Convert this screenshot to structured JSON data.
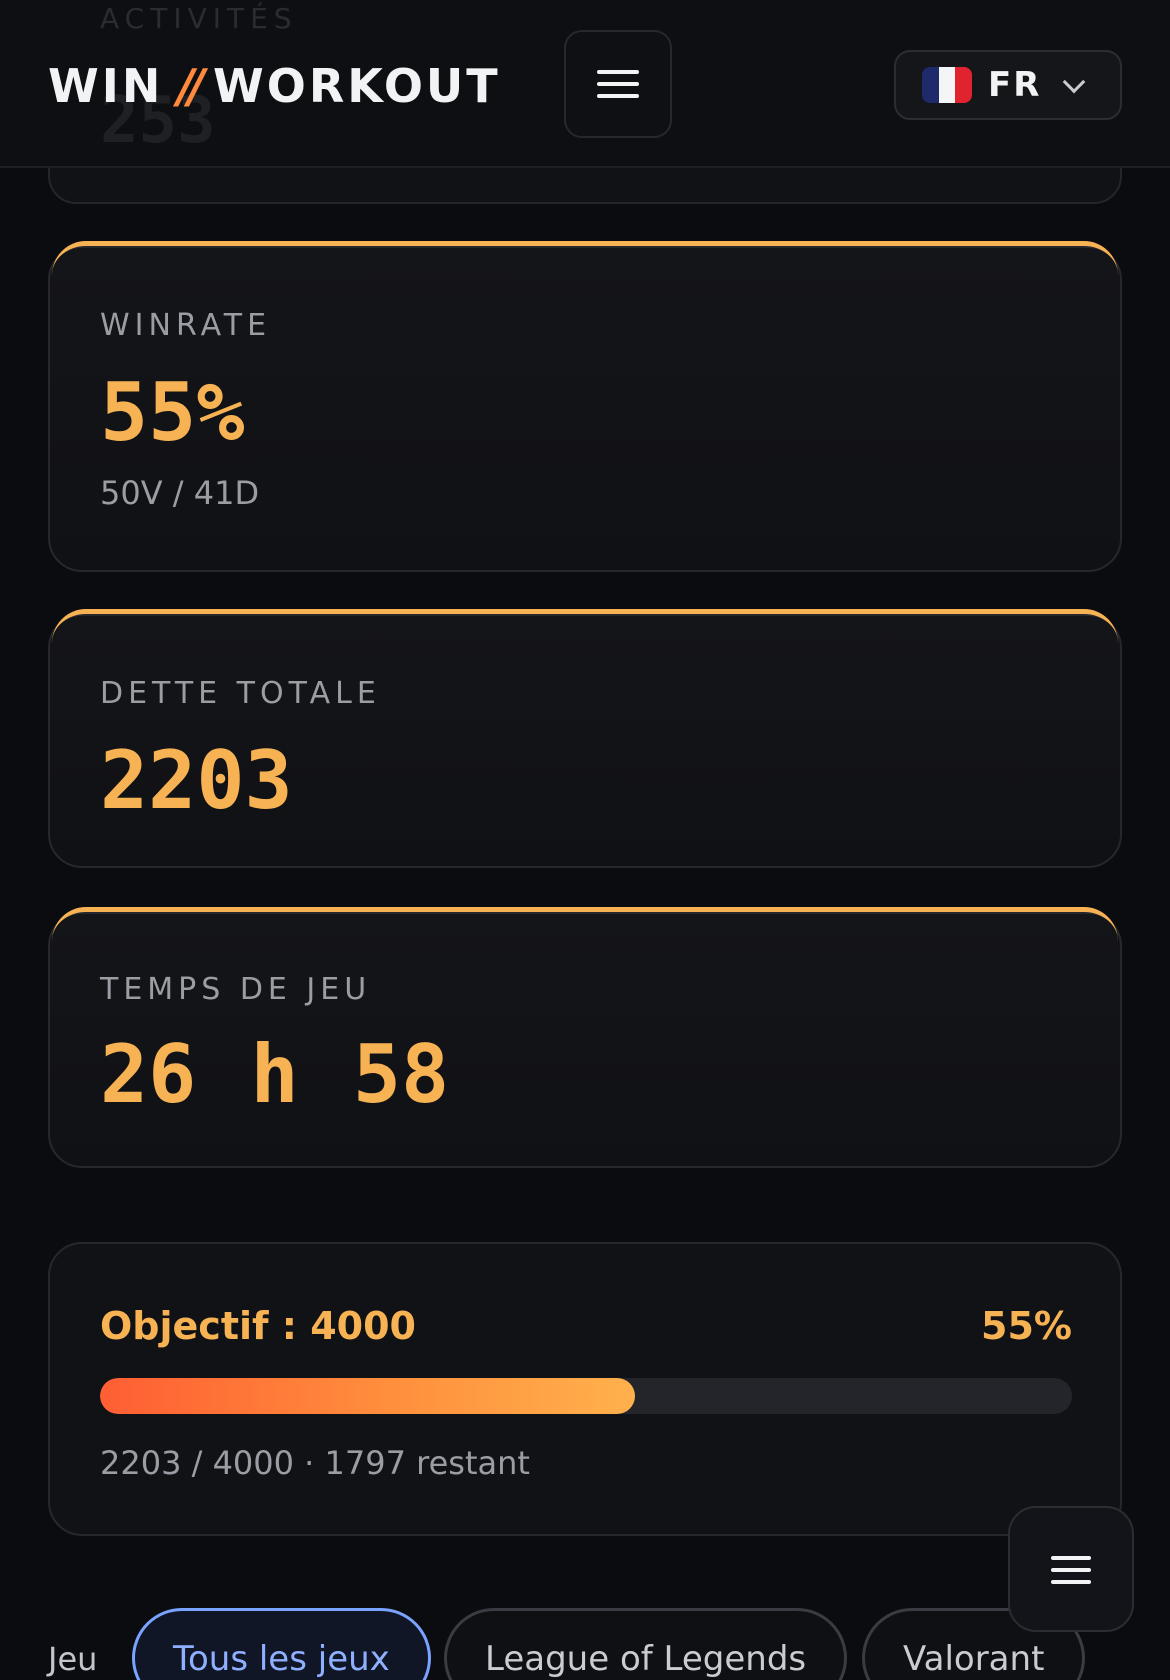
{
  "header": {
    "ghost_label": "ACTIVITÉS",
    "ghost_value": "253",
    "logo_left": "WIN",
    "logo_slash": "//",
    "logo_right": "WORKOUT",
    "language": {
      "code": "FR",
      "flag": "france-flag-icon"
    },
    "menu_icon": "hamburger-icon"
  },
  "cards": [
    {
      "label": "WINRATE",
      "value": "55%",
      "sub": "50V / 41D"
    },
    {
      "label": "DETTE TOTALE",
      "value": "2203"
    },
    {
      "label": "TEMPS DE JEU",
      "value": "26 h 58"
    }
  ],
  "goal": {
    "title": "Objectif : 4000",
    "percent_label": "55%",
    "progress": 0.55,
    "summary": "2203 / 4000 · 1797 restant"
  },
  "filters": {
    "label": "Jeu",
    "options": [
      "Tous les jeux",
      "League of Legends",
      "Valorant"
    ],
    "selected": "Tous les jeux"
  },
  "colors": {
    "accent": "#f7b254",
    "progress_start": "#ff5e33",
    "progress_end": "#ffb14d",
    "chip_active": "#7aa2ff"
  }
}
